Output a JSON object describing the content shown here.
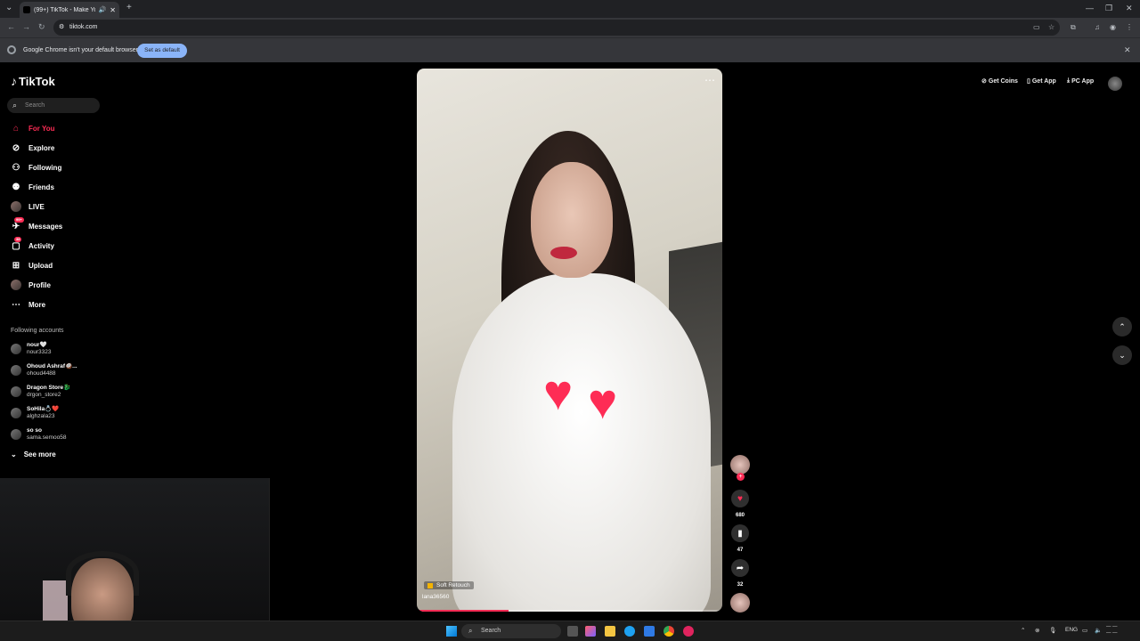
{
  "browser": {
    "tab_title": "(99+) TikTok - Make Your D",
    "url": "tiktok.com",
    "infobar_message": "Google Chrome isn't your default browser",
    "set_default_label": "Set as default"
  },
  "sidebar": {
    "logo": "TikTok",
    "search_placeholder": "Search",
    "items": [
      {
        "label": "For You",
        "icon": "home-icon"
      },
      {
        "label": "Explore",
        "icon": "compass-icon"
      },
      {
        "label": "Following",
        "icon": "user-follow-icon"
      },
      {
        "label": "Friends",
        "icon": "friends-icon"
      },
      {
        "label": "LIVE",
        "icon": "live-icon"
      },
      {
        "label": "Messages",
        "icon": "message-icon",
        "badge": "99+"
      },
      {
        "label": "Activity",
        "icon": "activity-icon",
        "badge": "38"
      },
      {
        "label": "Upload",
        "icon": "upload-icon"
      },
      {
        "label": "Profile",
        "icon": "profile-avatar"
      },
      {
        "label": "More",
        "icon": "more-icon"
      }
    ],
    "following_title": "Following accounts",
    "accounts": [
      {
        "name": "nour🤍",
        "handle": "nour3323"
      },
      {
        "name": "Ohoud Ashraf🥥...",
        "handle": "ohoud4488"
      },
      {
        "name": "Dragon Store🐉",
        "handle": "drgon_store2"
      },
      {
        "name": "SoHila💍❤️",
        "handle": "alghzala23"
      },
      {
        "name": "so so",
        "handle": "sama.semoo58"
      }
    ],
    "see_more": "See more"
  },
  "topbar": {
    "get_coins": "Get Coins",
    "get_app": "Get App",
    "pc_app": "PC App"
  },
  "video": {
    "effect_tag": "Soft Retouch",
    "username": "lana36560",
    "progress": 0.3
  },
  "actions": {
    "likes": "680",
    "saves": "47",
    "shares": "32"
  },
  "taskbar": {
    "search_label": "Search",
    "lang": "ENG"
  },
  "colors": {
    "accent": "#fe2c55",
    "chrome_dark": "#202124",
    "chrome_bar": "#35363a"
  }
}
